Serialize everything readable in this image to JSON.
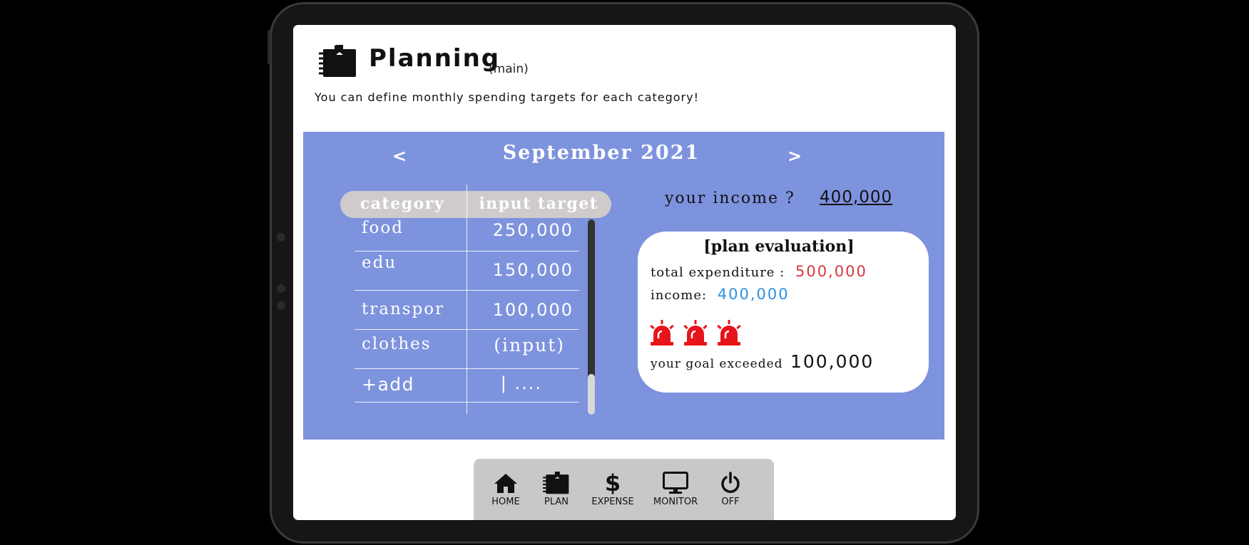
{
  "header": {
    "title": "Planning",
    "title_suffix": "(main)",
    "description": "You can define monthly spending targets for each category!",
    "icon": "planner-notebook-icon"
  },
  "period": {
    "label": "September 2021",
    "prev_label": "<",
    "next_label": ">"
  },
  "table": {
    "headers": [
      "category",
      "input target"
    ],
    "rows": [
      {
        "category": "food",
        "target": "250,000"
      },
      {
        "category": "edu",
        "target": "150,000"
      },
      {
        "category": "transpor",
        "target": "100,000"
      },
      {
        "category": "clothes",
        "target": "(input)"
      }
    ],
    "add_label": "+add",
    "add_input_placeholder": "| ...."
  },
  "income": {
    "label": "your income ?",
    "value": "400,000"
  },
  "evaluation": {
    "title": "[plan evaluation]",
    "total_label": "total expenditure :",
    "total_value": "500,000",
    "income_label": "income:",
    "income_value": "400,000",
    "alarm_count": 3,
    "exceed_label": "your goal exceeded",
    "exceed_value": "100,000"
  },
  "bottom_nav": {
    "items": [
      {
        "label": "HOME",
        "icon": "home-icon"
      },
      {
        "label": "PLAN",
        "icon": "planner-notebook-icon"
      },
      {
        "label": "EXPENSE",
        "icon": "dollar-icon"
      },
      {
        "label": "MONITOR",
        "icon": "monitor-icon"
      },
      {
        "label": "OFF",
        "icon": "power-icon"
      }
    ]
  },
  "colors": {
    "panel": "#7d93de",
    "table_header": "#cfcbcb",
    "expense_red": "#d9363e",
    "income_blue": "#2f8fe0",
    "alarm_red": "#e8141c",
    "nav_bg": "#c8c8c8"
  }
}
